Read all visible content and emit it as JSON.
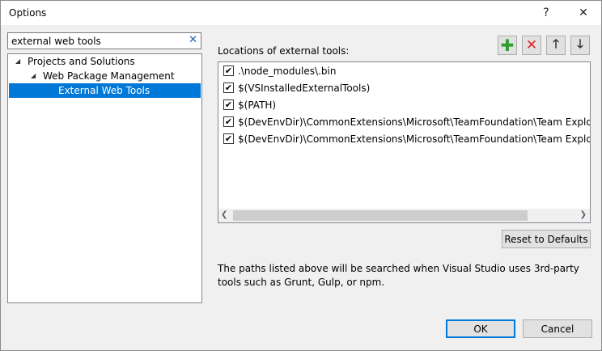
{
  "window": {
    "title": "Options",
    "help_glyph": "?",
    "close_glyph": "✕"
  },
  "search": {
    "value": "external web tools",
    "clear_glyph": "✕"
  },
  "tree": {
    "items": [
      {
        "label": "Projects and Solutions",
        "arrow": "◢"
      },
      {
        "label": "Web Package Management",
        "arrow": "◢"
      },
      {
        "label": "External Web Tools"
      }
    ]
  },
  "panel": {
    "locations_label": "Locations of external tools:",
    "toolbar": {
      "add": "✚",
      "remove": "✕",
      "up": "🡑",
      "down": "🡓"
    },
    "locations": [
      {
        "checked": true,
        "path": ".\\node_modules\\.bin"
      },
      {
        "checked": true,
        "path": "$(VSInstalledExternalTools)"
      },
      {
        "checked": true,
        "path": "$(PATH)"
      },
      {
        "checked": true,
        "path": "$(DevEnvDir)\\CommonExtensions\\Microsoft\\TeamFoundation\\Team Explorer\\Git\\"
      },
      {
        "checked": true,
        "path": "$(DevEnvDir)\\CommonExtensions\\Microsoft\\TeamFoundation\\Team Explorer\\Git\\"
      }
    ],
    "check_glyph": "✔",
    "scroll": {
      "left": "❮",
      "right": "❯"
    },
    "reset_label": "Reset to Defaults",
    "description": "The paths listed above will be searched when Visual Studio uses 3rd-party tools such as Grunt, Gulp, or npm."
  },
  "footer": {
    "ok_label": "OK",
    "cancel_label": "Cancel"
  },
  "colors": {
    "selection": "#0078d7",
    "add": "#2f9e2f",
    "remove": "#dd2222"
  }
}
